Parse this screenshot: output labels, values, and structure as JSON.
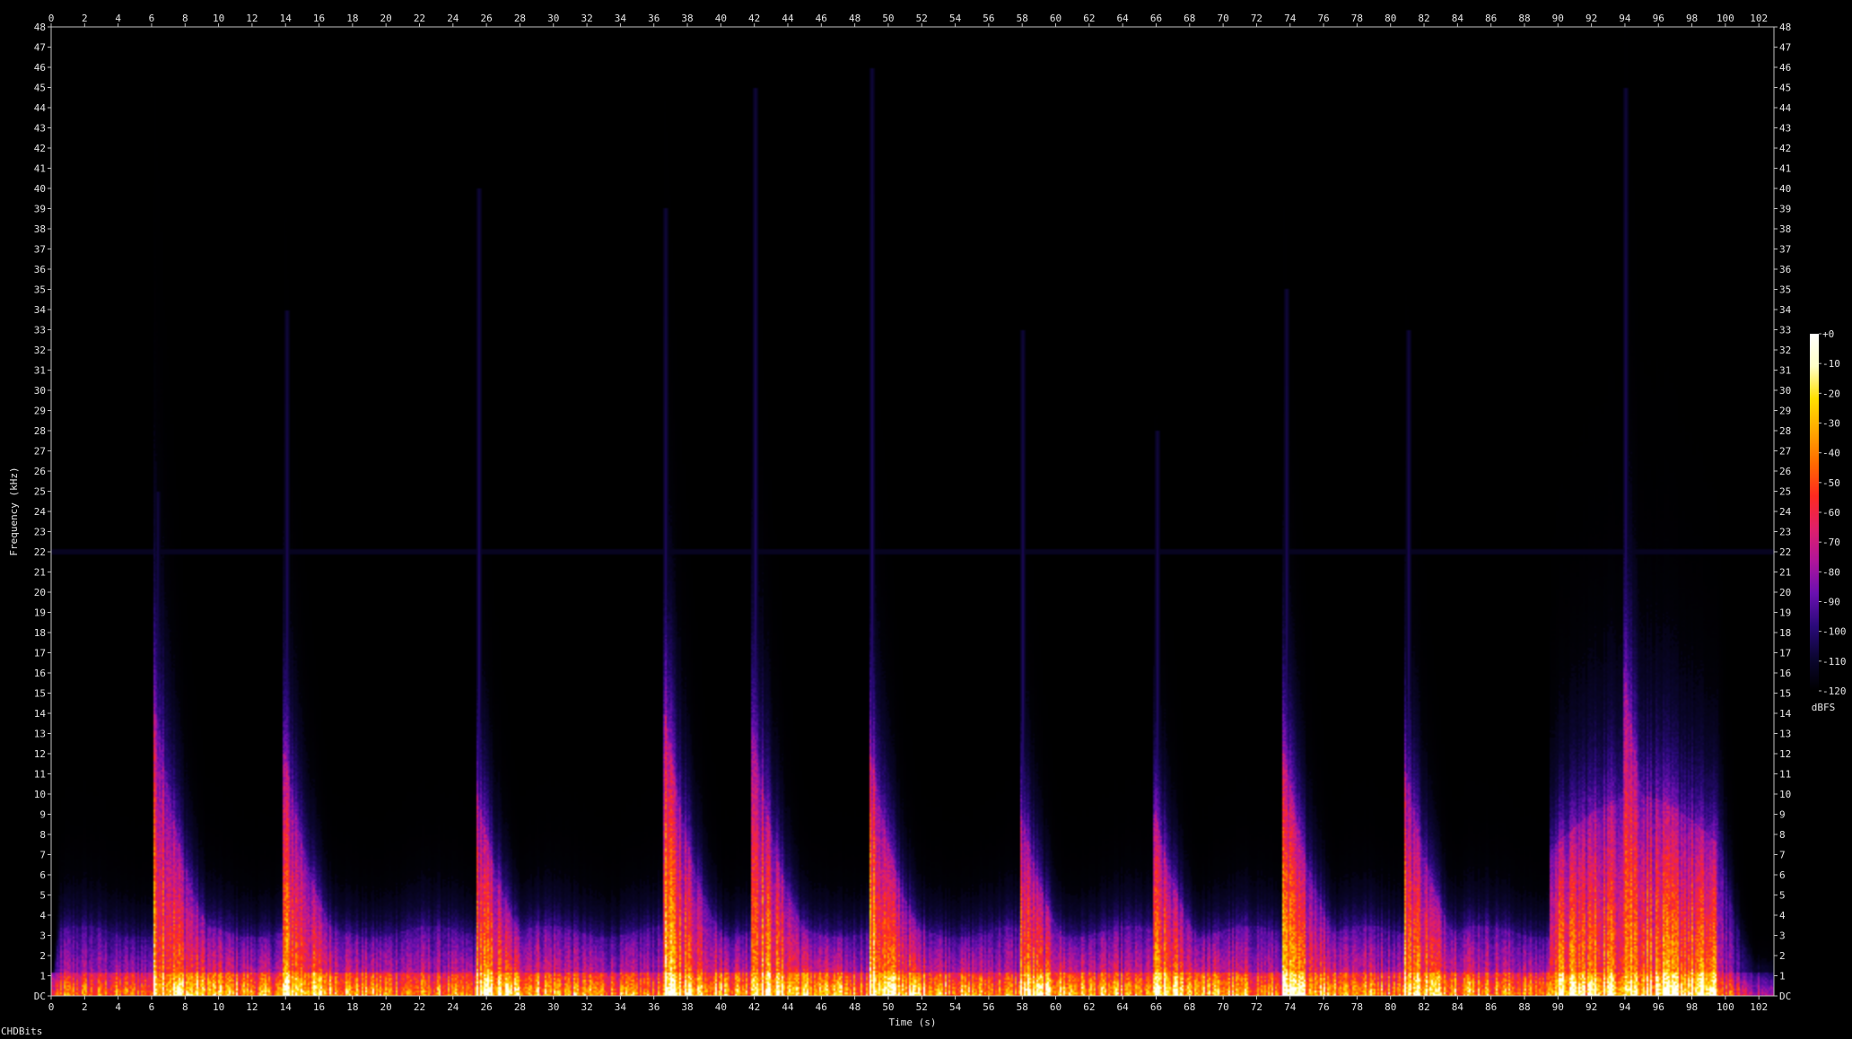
{
  "chart_data": {
    "type": "heatmap",
    "title": "",
    "xlabel": "Time (s)",
    "ylabel": "Frequency (kHz)",
    "xlim": [
      0,
      102.9
    ],
    "ylim": [
      0,
      48
    ],
    "x_ticks": [
      0,
      2,
      4,
      6,
      8,
      10,
      12,
      14,
      16,
      18,
      20,
      22,
      24,
      26,
      28,
      30,
      32,
      34,
      36,
      38,
      40,
      42,
      44,
      46,
      48,
      50,
      52,
      54,
      56,
      58,
      60,
      62,
      64,
      66,
      68,
      70,
      72,
      74,
      76,
      78,
      80,
      82,
      84,
      86,
      88,
      90,
      92,
      94,
      96,
      98,
      100,
      102
    ],
    "y_ticks": [
      0,
      1,
      2,
      3,
      4,
      5,
      6,
      7,
      8,
      9,
      10,
      11,
      12,
      13,
      14,
      15,
      16,
      17,
      18,
      19,
      20,
      21,
      22,
      23,
      24,
      25,
      26,
      27,
      28,
      29,
      30,
      31,
      32,
      33,
      34,
      35,
      36,
      37,
      38,
      39,
      40,
      41,
      42,
      43,
      44,
      45,
      46,
      47,
      48
    ],
    "y_zero_label": "DC",
    "colorbar": {
      "label": "dBFS",
      "ticks": [
        "+0",
        "-10",
        "-20",
        "-30",
        "-40",
        "-50",
        "-60",
        "-70",
        "-80",
        "-90",
        "-100",
        "-110",
        "-120"
      ],
      "range": [
        -120,
        0
      ],
      "colors": [
        "#000000",
        "#0b0630",
        "#2a0a7a",
        "#6a10b0",
        "#b0159a",
        "#e0206a",
        "#ff2a20",
        "#ff6a00",
        "#ffa800",
        "#ffe000",
        "#ffffc8",
        "#ffffff"
      ]
    },
    "hum_line_khz": 22,
    "events": [
      {
        "t": 6.3,
        "top_khz": 14,
        "strength": 0.9,
        "spike_khz": 25
      },
      {
        "t": 14.0,
        "top_khz": 12,
        "strength": 0.85,
        "spike_khz": 34
      },
      {
        "t": 25.5,
        "top_khz": 10,
        "strength": 0.9,
        "spike_khz": 40
      },
      {
        "t": 36.7,
        "top_khz": 14,
        "strength": 1.0,
        "spike_khz": 39
      },
      {
        "t": 42.0,
        "top_khz": 13,
        "strength": 1.0,
        "spike_khz": 45
      },
      {
        "t": 49.0,
        "top_khz": 12,
        "strength": 1.0,
        "spike_khz": 46
      },
      {
        "t": 58.0,
        "top_khz": 9,
        "strength": 0.8,
        "spike_khz": 33
      },
      {
        "t": 66.0,
        "top_khz": 9,
        "strength": 0.8,
        "spike_khz": 28
      },
      {
        "t": 73.7,
        "top_khz": 12,
        "strength": 0.9,
        "spike_khz": 35
      },
      {
        "t": 81.0,
        "top_khz": 11,
        "strength": 0.9,
        "spike_khz": 33
      },
      {
        "t": 94.0,
        "top_khz": 16,
        "strength": 1.0,
        "spike_khz": 45
      }
    ],
    "loud_region": {
      "t_start": 89.5,
      "t_end": 99.5,
      "top_khz": 9
    }
  },
  "footer": {
    "credit": "CHDBits"
  }
}
